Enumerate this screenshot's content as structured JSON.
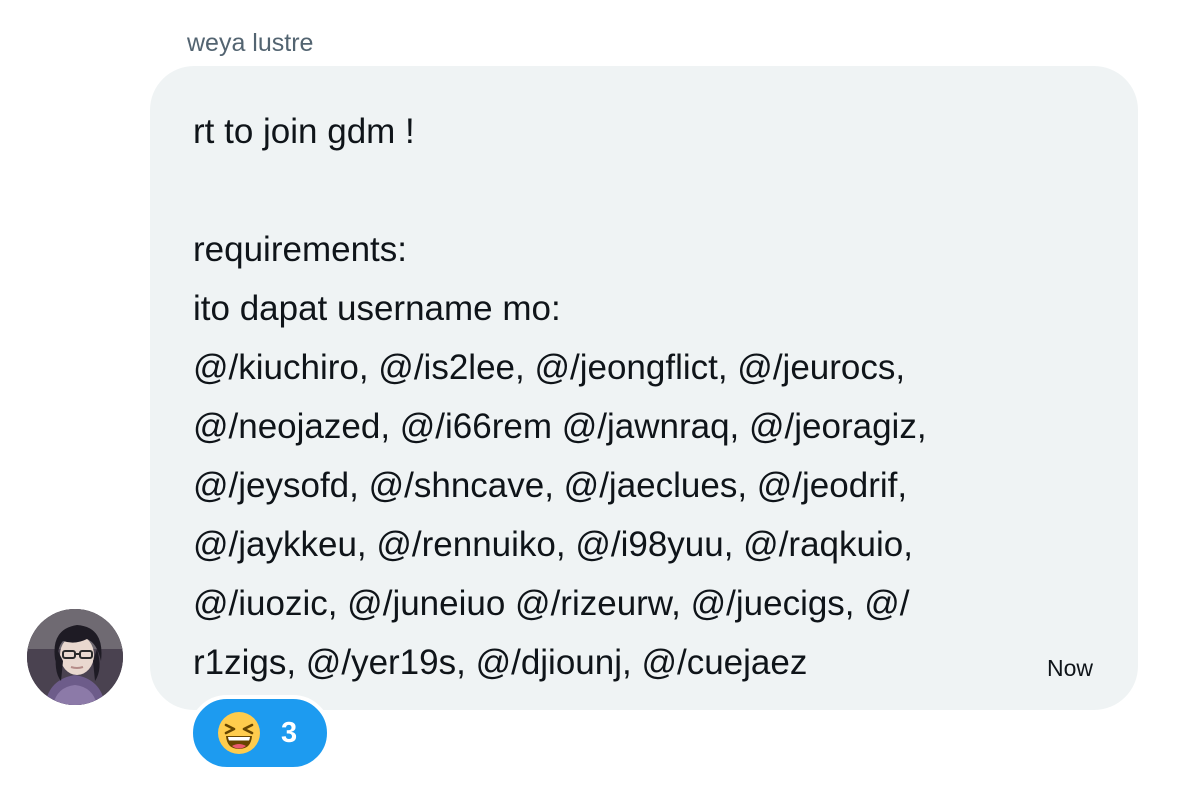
{
  "message": {
    "sender_name": "weya lustre",
    "lines": [
      "rt to join gdm !",
      "",
      "requirements:",
      "ito dapat username mo:",
      "@/kiuchiro, @/is2lee, @/jeongflict, @/jeurocs,",
      "@/neojazed, @/i66rem @/jawnraq, @/jeoragiz,",
      "@/jeysofd, @/shncave, @/jaeclues, @/jeodrif,",
      "@/jaykkeu, @/rennuiko, @/i98yuu, @/raqkuio,",
      "@/iuozic, @/juneiuo @/rizeurw, @/juecigs, @/",
      "r1zigs, @/yer19s, @/djiounj, @/cuejaez"
    ],
    "timestamp": "Now",
    "bubble_color": "#eff3f4"
  },
  "reaction": {
    "emoji_icon": "grinning-squinting-face-icon",
    "count": "3",
    "color": "#1d9bf0"
  },
  "avatar": {
    "icon": "user-avatar-icon"
  }
}
